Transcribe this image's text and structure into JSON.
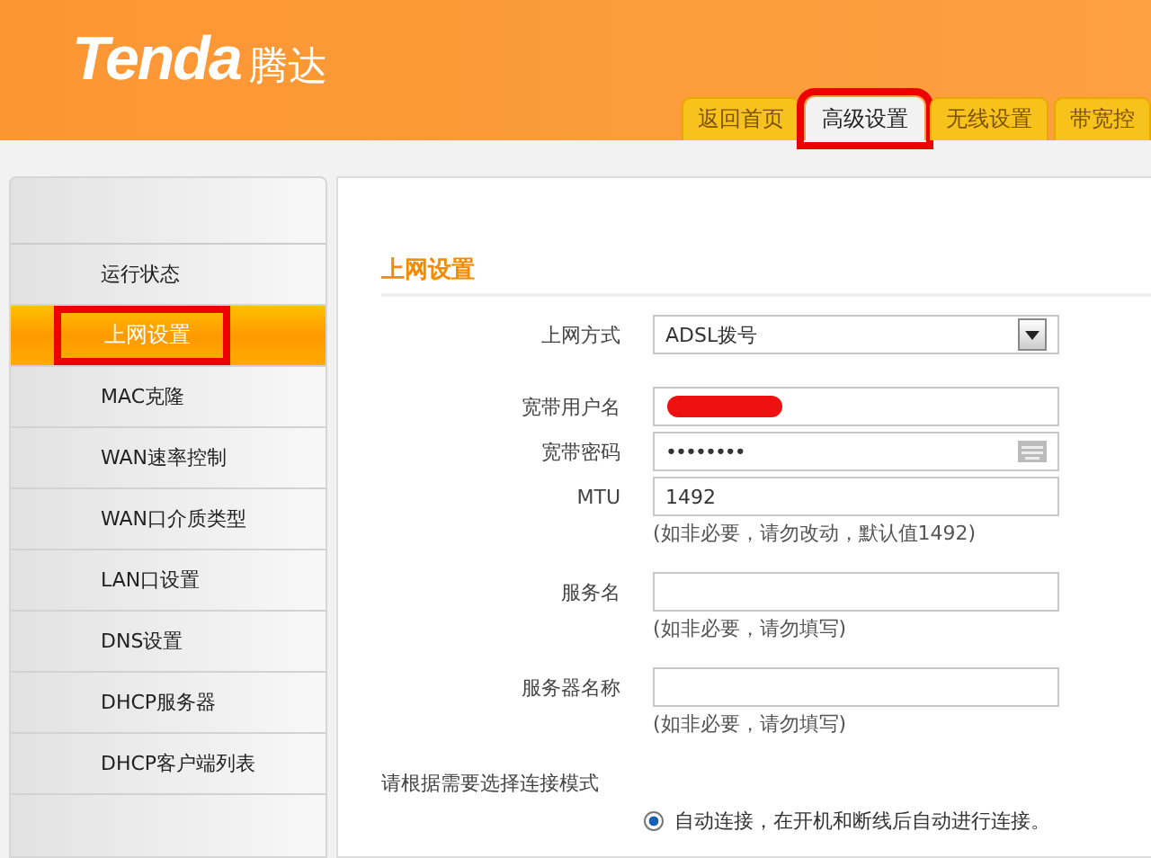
{
  "header": {
    "brand": "Tenda",
    "brand_cn": "腾达"
  },
  "tabs": [
    {
      "label": "返回首页",
      "selected": false,
      "highlighted": false
    },
    {
      "label": "高级设置",
      "selected": true,
      "highlighted": true
    },
    {
      "label": "无线设置",
      "selected": false,
      "highlighted": false
    },
    {
      "label": "带宽控",
      "selected": false,
      "highlighted": false
    }
  ],
  "sidebar": {
    "items": [
      {
        "label": "运行状态",
        "selected": false,
        "highlighted": false
      },
      {
        "label": "上网设置",
        "selected": true,
        "highlighted": true
      },
      {
        "label": "MAC克隆",
        "selected": false,
        "highlighted": false
      },
      {
        "label": "WAN速率控制",
        "selected": false,
        "highlighted": false
      },
      {
        "label": "WAN口介质类型",
        "selected": false,
        "highlighted": false
      },
      {
        "label": "LAN口设置",
        "selected": false,
        "highlighted": false
      },
      {
        "label": "DNS设置",
        "selected": false,
        "highlighted": false
      },
      {
        "label": "DHCP服务器",
        "selected": false,
        "highlighted": false
      },
      {
        "label": "DHCP客户端列表",
        "selected": false,
        "highlighted": false
      }
    ]
  },
  "form": {
    "title": "上网设置",
    "fields": [
      {
        "kind": "select",
        "label": "上网方式",
        "value": "ADSL拨号"
      },
      {
        "kind": "redacted",
        "label": "宽带用户名"
      },
      {
        "kind": "password",
        "label": "宽带密码",
        "value": "••••••••"
      },
      {
        "kind": "text",
        "label": "MTU",
        "value": "1492",
        "hint": "(如非必要，请勿改动，默认值1492)"
      },
      {
        "kind": "text",
        "label": "服务名",
        "hint": "(如非必要，请勿填写)"
      },
      {
        "kind": "text",
        "label": "服务器名称",
        "hint": "(如非必要，请勿填写)"
      }
    ],
    "mode_prompt": "请根据需要选择连接模式",
    "modes": [
      {
        "label": "自动连接，在开机和断线后自动进行连接。",
        "selected": true
      }
    ]
  }
}
